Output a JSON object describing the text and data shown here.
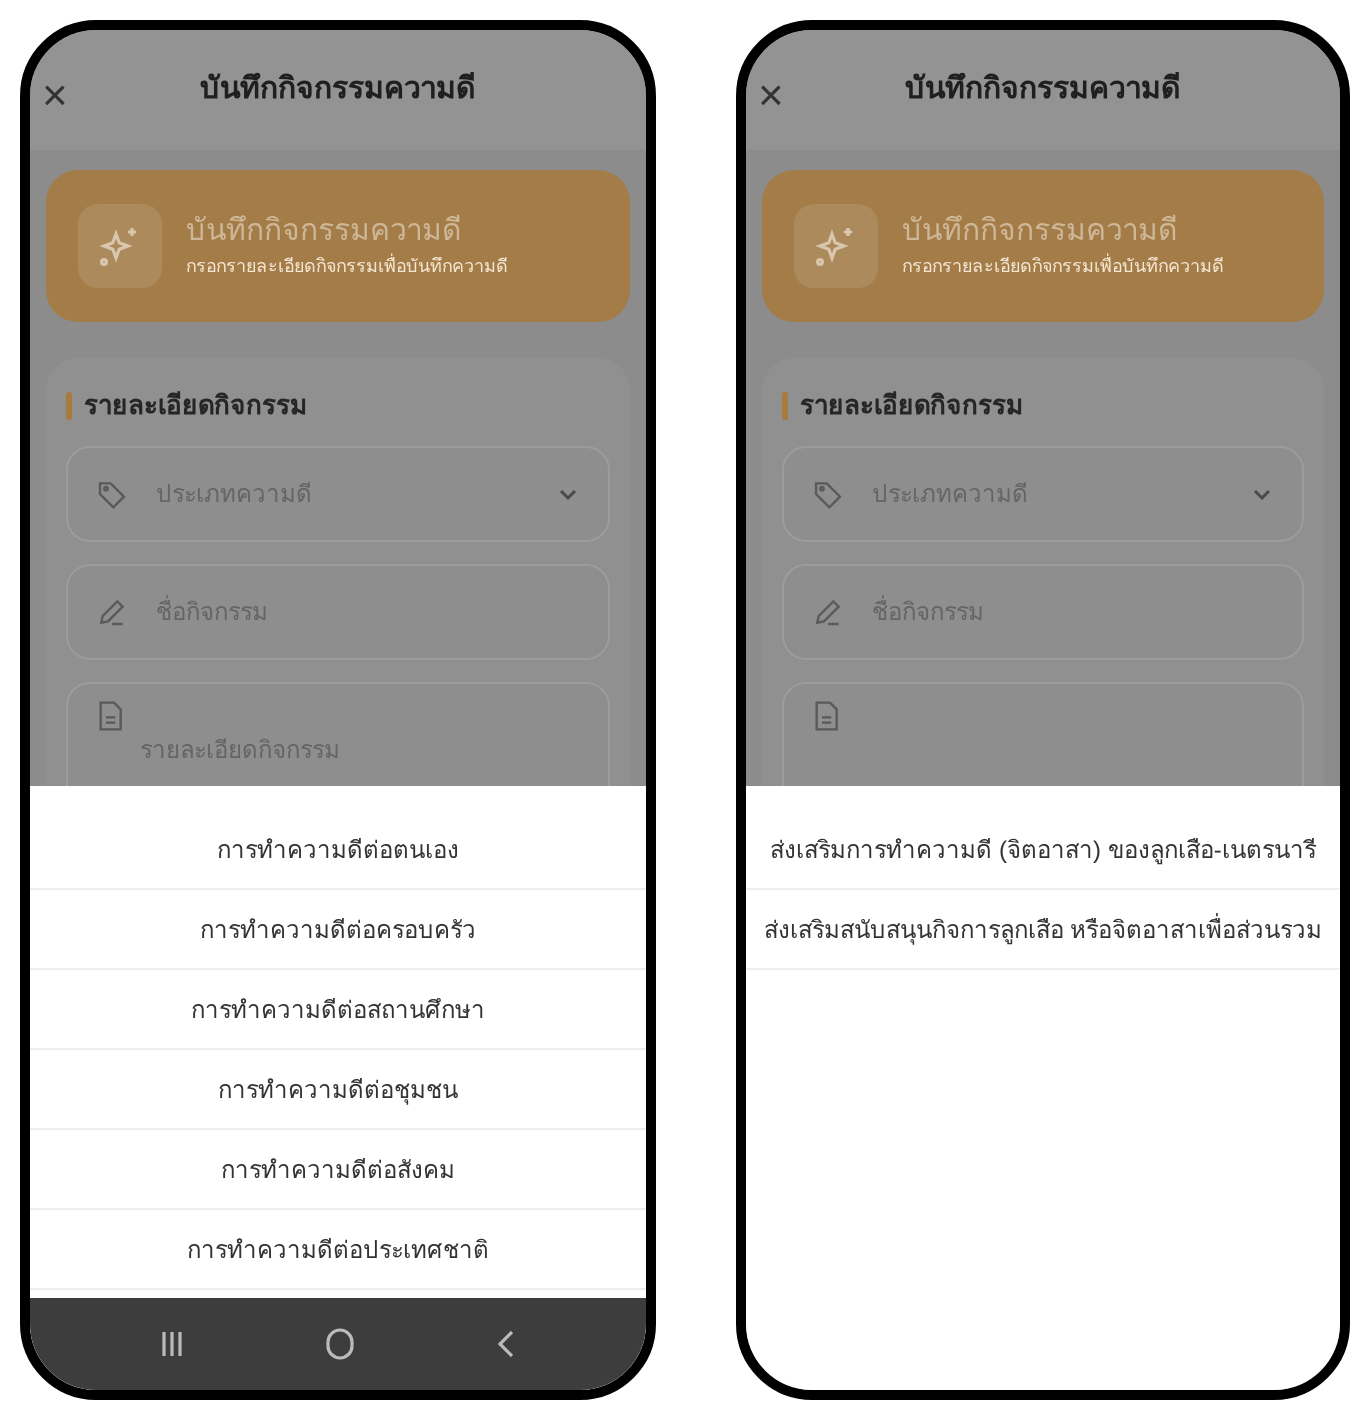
{
  "phones": [
    {
      "header": {
        "close": "×",
        "title": "บันทึกกิจกรรมความดี"
      },
      "banner": {
        "title": "บันทึกกิจกรรมความดี",
        "subtitle": "กรอกรายละเอียดกิจกรรมเพื่อบันทึกความดี"
      },
      "section_title": "รายละเอียดกิจกรรม",
      "fields": [
        {
          "kind": "select",
          "placeholder": "ประเภทความดี"
        },
        {
          "kind": "text",
          "placeholder": "ชื่อกิจกรรม"
        },
        {
          "kind": "textarea",
          "placeholder": "รายละเอียดกิจกรรม"
        }
      ],
      "sheet": {
        "options": [
          "การทำความดีต่อตนเอง",
          "การทำความดีต่อครอบครัว",
          "การทำความดีต่อสถานศึกษา",
          "การทำความดีต่อชุมชน",
          "การทำความดีต่อสังคม",
          "การทำความดีต่อประเทศชาติ"
        ]
      },
      "nav_bar": true
    },
    {
      "header": {
        "close": "×",
        "title": "บันทึกกิจกรรมความดี"
      },
      "banner": {
        "title": "บันทึกกิจกรรมความดี",
        "subtitle": "กรอกรายละเอียดกิจกรรมเพื่อบันทึกความดี"
      },
      "section_title": "รายละเอียดกิจกรรม",
      "fields": [
        {
          "kind": "select",
          "placeholder": "ประเภทความดี"
        },
        {
          "kind": "text",
          "placeholder": "ชื่อกิจกรรม"
        },
        {
          "kind": "textarea"
        }
      ],
      "sheet": {
        "options": [
          "ส่งเสริมการทำความดี (จิตอาสา) ของลูกเสือ-เนตรนารี",
          "ส่งเสริมสนับสนุนกิจการลูกเสือ หรือจิตอาสาเพื่อส่วนรวม"
        ]
      },
      "nav_bar": false
    }
  ]
}
